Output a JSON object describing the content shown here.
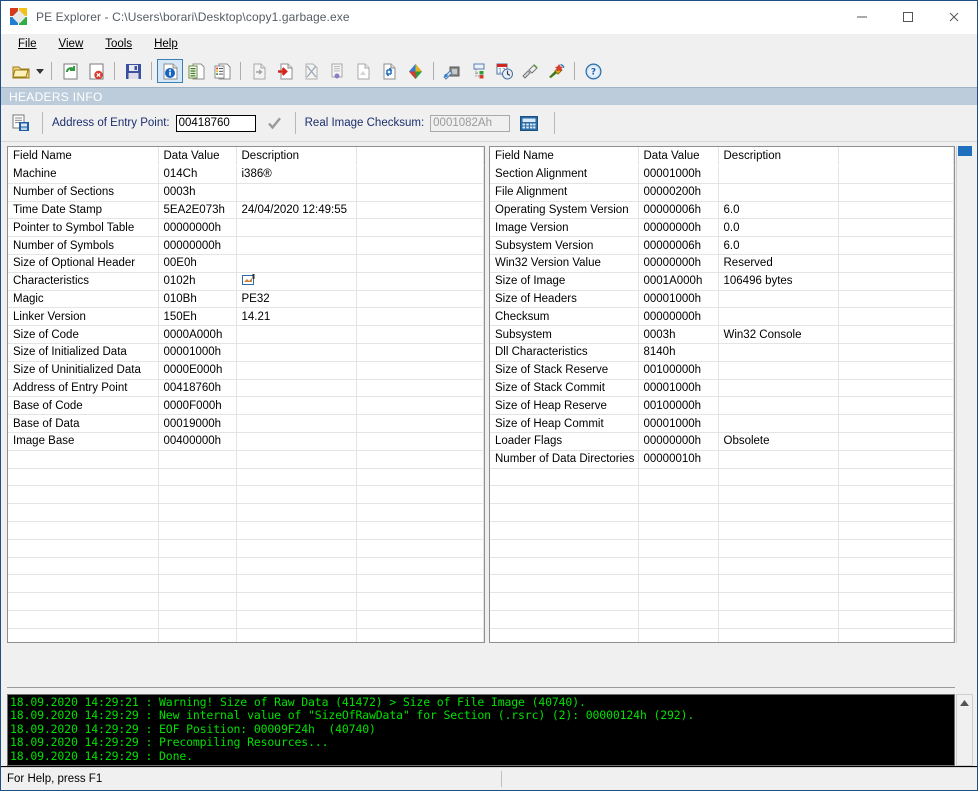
{
  "window": {
    "title": "PE Explorer - C:\\Users\\borari\\Desktop\\copy1.garbage.exe",
    "minimize_label": "Minimize",
    "maximize_label": "Maximize",
    "close_label": "Close",
    "icon": "pe-explorer-icon"
  },
  "menu": {
    "items": [
      {
        "label": "File",
        "accel": "F"
      },
      {
        "label": "View",
        "accel": "V"
      },
      {
        "label": "Tools",
        "accel": "T"
      },
      {
        "label": "Help",
        "accel": "H"
      }
    ]
  },
  "toolbar": {
    "buttons": [
      {
        "name": "open-file-icon",
        "title": "Open File"
      },
      {
        "name": "open-dropdown-caret-icon",
        "title": "Recent Files"
      },
      {
        "name": "refresh-icon",
        "title": "Reopen File"
      },
      {
        "name": "close-file-icon",
        "title": "Close File"
      },
      {
        "name": "save-icon",
        "title": "Save File"
      },
      {
        "name": "headers-info-icon",
        "title": "Headers Info",
        "selected": true
      },
      {
        "name": "data-directories-icon",
        "title": "Data Directories"
      },
      {
        "name": "section-headers-icon",
        "title": "Section Headers"
      },
      {
        "name": "export-icon",
        "title": "Export"
      },
      {
        "name": "import-icon",
        "title": "Import"
      },
      {
        "name": "delay-import-icon",
        "title": "Delay Import"
      },
      {
        "name": "resource-icon",
        "title": "Resources"
      },
      {
        "name": "debug-icon",
        "title": "Debug Info"
      },
      {
        "name": "relocations-icon",
        "title": "Relocations"
      },
      {
        "name": "color-diamond-icon",
        "title": "Resource Editor"
      },
      {
        "name": "disassembler-icon",
        "title": "Disassembler"
      },
      {
        "name": "dependency-scanner-icon",
        "title": "Dependency Scanner"
      },
      {
        "name": "timedate-icon",
        "title": "Time Date Stamp Adjuster"
      },
      {
        "name": "cleaner-icon",
        "title": "Resource Cleaner"
      },
      {
        "name": "rebuilder-icon",
        "title": "UPX Unpacker"
      },
      {
        "name": "help-icon",
        "title": "Help"
      }
    ]
  },
  "banner": {
    "title": "HEADERS INFO"
  },
  "entry_bar": {
    "copy_icon": "copy-headers-icon",
    "entry_point_label": "Address of Entry Point:",
    "entry_point_value": "00418760",
    "validate_icon": "checkmark-icon",
    "checksum_label": "Real Image Checksum:",
    "checksum_value": "0001082Ah",
    "calculator_icon": "calculator-icon"
  },
  "tables": {
    "columns": [
      "Field Name",
      "Data Value",
      "Description"
    ],
    "left_rows": [
      {
        "field": "Machine",
        "value": "014Ch",
        "desc": "i386®"
      },
      {
        "field": "Number of Sections",
        "value": "0003h",
        "desc": ""
      },
      {
        "field": "Time Date Stamp",
        "value": "5EA2E073h",
        "desc": "24/04/2020  12:49:55"
      },
      {
        "field": "Pointer to Symbol Table",
        "value": "00000000h",
        "desc": ""
      },
      {
        "field": "Number of Symbols",
        "value": "00000000h",
        "desc": ""
      },
      {
        "field": "Size of Optional Header",
        "value": "00E0h",
        "desc": ""
      },
      {
        "field": "Characteristics",
        "value": "0102h",
        "desc": "",
        "desc_icon": "edit-flags-icon"
      },
      {
        "field": "Magic",
        "value": "010Bh",
        "desc": "PE32"
      },
      {
        "field": "Linker Version",
        "value": "150Eh",
        "desc": "14.21"
      },
      {
        "field": "Size of Code",
        "value": "0000A000h",
        "desc": ""
      },
      {
        "field": "Size of Initialized Data",
        "value": "00001000h",
        "desc": ""
      },
      {
        "field": "Size of Uninitialized Data",
        "value": "0000E000h",
        "desc": ""
      },
      {
        "field": "Address of Entry Point",
        "value": "00418760h",
        "desc": ""
      },
      {
        "field": "Base of Code",
        "value": "0000F000h",
        "desc": ""
      },
      {
        "field": "Base of Data",
        "value": "00019000h",
        "desc": ""
      },
      {
        "field": "Image Base",
        "value": "00400000h",
        "desc": ""
      }
    ],
    "right_rows": [
      {
        "field": "Section Alignment",
        "value": "00001000h",
        "desc": ""
      },
      {
        "field": "File Alignment",
        "value": "00000200h",
        "desc": ""
      },
      {
        "field": "Operating System Version",
        "value": "00000006h",
        "desc": "6.0"
      },
      {
        "field": "Image Version",
        "value": "00000000h",
        "desc": "0.0"
      },
      {
        "field": "Subsystem Version",
        "value": "00000006h",
        "desc": "6.0"
      },
      {
        "field": "Win32 Version Value",
        "value": "00000000h",
        "desc": "Reserved"
      },
      {
        "field": "Size of Image",
        "value": "0001A000h",
        "desc": "106496 bytes"
      },
      {
        "field": "Size of Headers",
        "value": "00001000h",
        "desc": ""
      },
      {
        "field": "Checksum",
        "value": "00000000h",
        "desc": ""
      },
      {
        "field": "Subsystem",
        "value": "0003h",
        "desc": "Win32 Console"
      },
      {
        "field": "Dll Characteristics",
        "value": "8140h",
        "desc": ""
      },
      {
        "field": "Size of Stack Reserve",
        "value": "00100000h",
        "desc": ""
      },
      {
        "field": "Size of Stack Commit",
        "value": "00001000h",
        "desc": ""
      },
      {
        "field": "Size of Heap Reserve",
        "value": "00100000h",
        "desc": ""
      },
      {
        "field": "Size of Heap Commit",
        "value": "00001000h",
        "desc": ""
      },
      {
        "field": "Loader Flags",
        "value": "00000000h",
        "desc": "Obsolete"
      },
      {
        "field": "Number of Data Directories",
        "value": "00000010h",
        "desc": ""
      }
    ]
  },
  "console": {
    "lines": [
      "18.09.2020 14:29:21 : Warning! Size of Raw Data (41472) > Size of File Image (40740).",
      "18.09.2020 14:29:29 : New internal value of \"SizeOfRawData\" for Section (.rsrc) (2): 00000124h (292).",
      "18.09.2020 14:29:29 : EOF Position: 00009F24h  (40740)",
      "18.09.2020 14:29:29 : Precompiling Resources...",
      "18.09.2020 14:29:29 : Done."
    ],
    "scroll_up_icon": "scroll-up-arrow-icon"
  },
  "statusbar": {
    "text": "For Help, press F1"
  },
  "colors": {
    "banner_bg": "#bcccdb",
    "console_text": "#00e000",
    "console_bg": "#000000",
    "label_blue": "#1c2f6e",
    "window_border": "#1f4f82",
    "selected_toolbar": "#d6e8f8"
  }
}
